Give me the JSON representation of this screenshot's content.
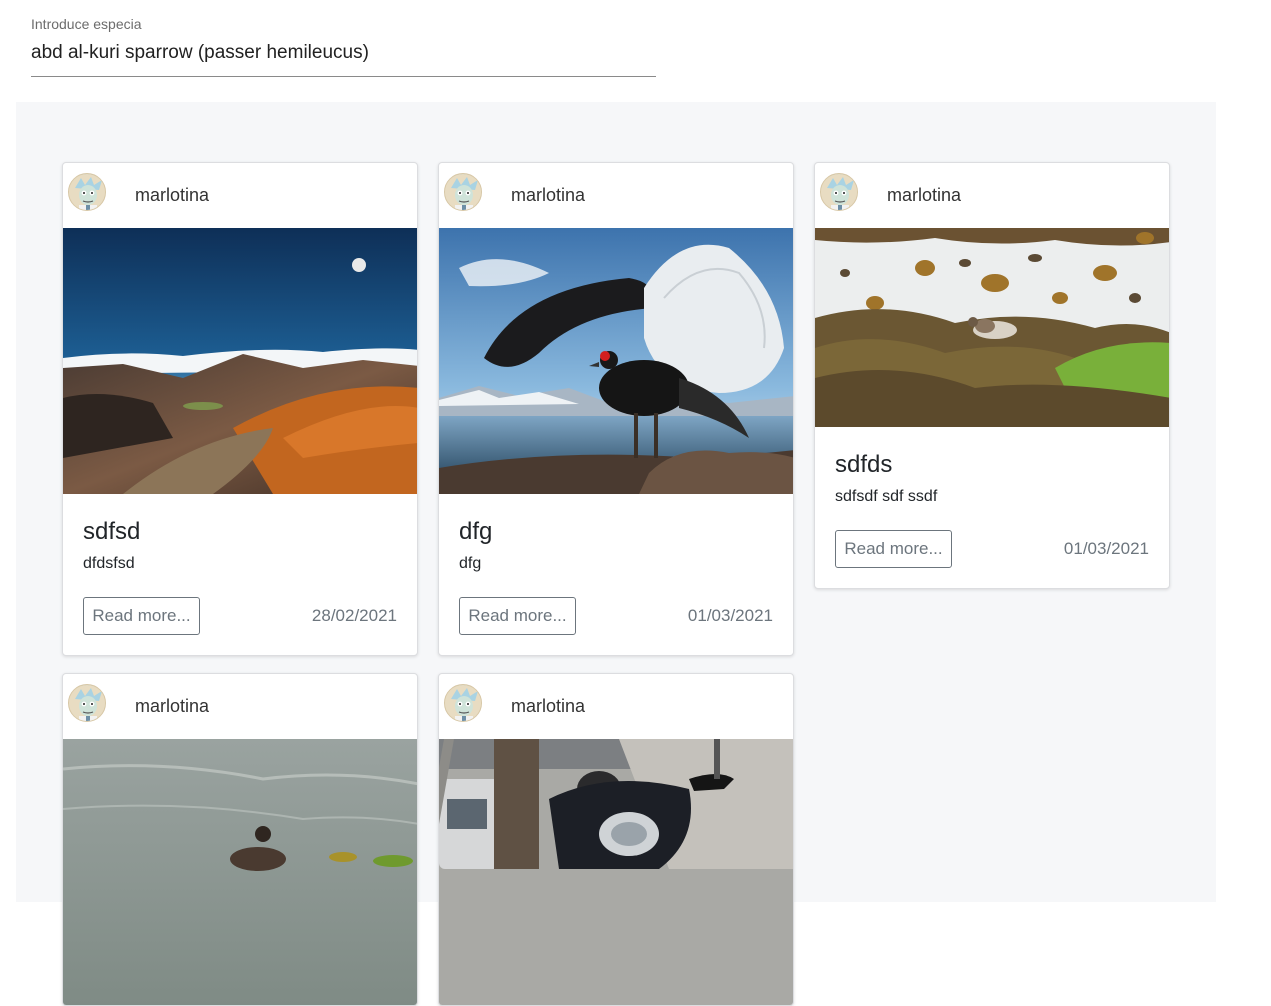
{
  "search": {
    "label": "Introduce especia",
    "value": "abd al-kuri sparrow (passer hemileucus)"
  },
  "actions": {
    "read_more_label": "Read more..."
  },
  "cards": [
    {
      "author": "marlotina",
      "image": "volcanic-crater-landscape",
      "title": "sdfsd",
      "text": "dfdsfsd",
      "date": "28/02/2021"
    },
    {
      "author": "marlotina",
      "image": "black-grouse-displaying",
      "title": "dfg",
      "text": "dfg",
      "date": "01/03/2021"
    },
    {
      "author": "marlotina",
      "image": "sandpiper-on-seaweed",
      "title": "sdfds",
      "text": "sdfsdf sdf ssdf",
      "date": "01/03/2021"
    },
    {
      "author": "marlotina",
      "image": "duck-on-water"
    },
    {
      "author": "marlotina",
      "image": "motorcycle-on-street"
    }
  ],
  "colors": {
    "feed_background": "#f6f7f9",
    "outline_button": "#6c757d",
    "search_underline": "#8a8a8a"
  }
}
